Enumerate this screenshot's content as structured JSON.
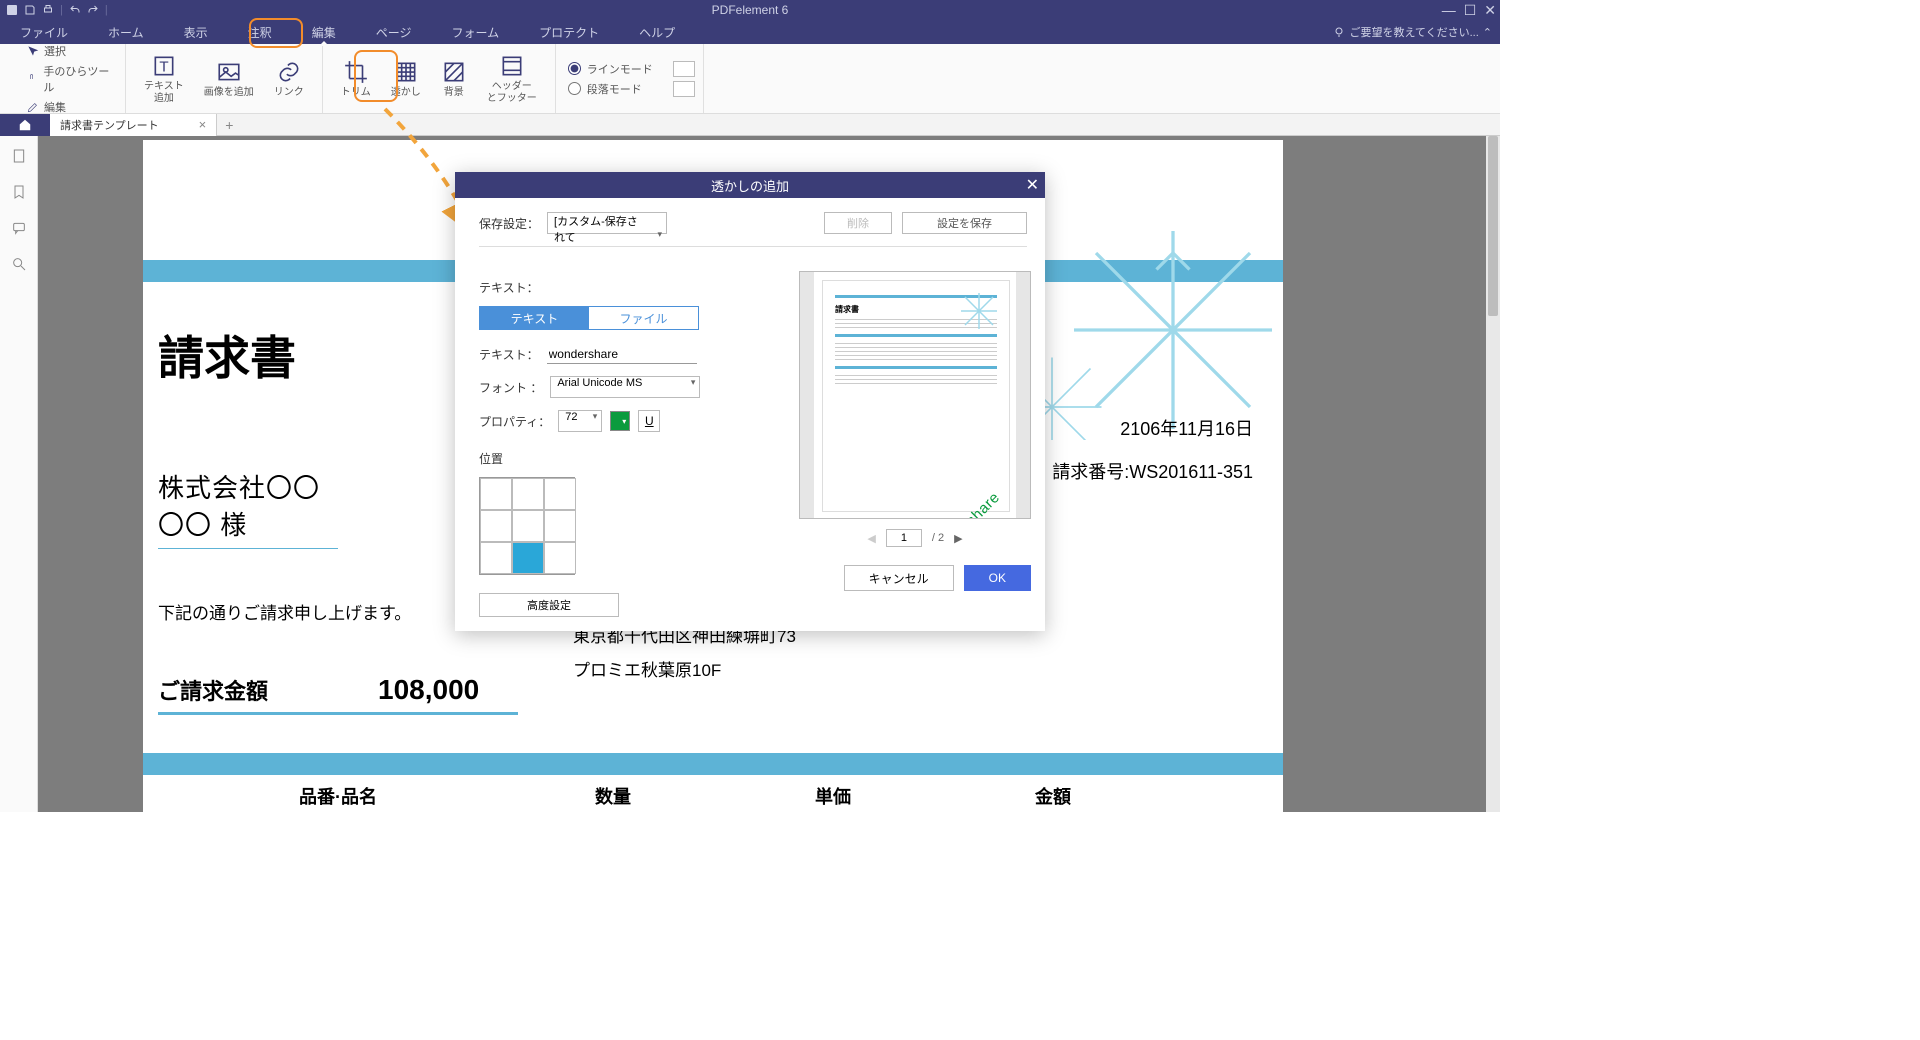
{
  "app": {
    "title": "PDFelement 6",
    "request_label": "ご要望を教えてください..."
  },
  "menu": {
    "file": "ファイル",
    "home": "ホーム",
    "view": "表示",
    "comment": "注釈",
    "edit": "編集",
    "page": "ページ",
    "form": "フォーム",
    "protect": "プロテクト",
    "help": "ヘルプ"
  },
  "ribbon": {
    "select": "選択",
    "hand": "手のひらツール",
    "edit": "編集",
    "text_add": "テキスト\n追加",
    "image_add": "画像を追加",
    "link": "リンク",
    "trim": "トリム",
    "watermark": "透かし",
    "background": "背景",
    "header_footer": "ヘッダー\nとフッター",
    "line_mode": "ラインモード",
    "para_mode": "段落モード"
  },
  "tabs": {
    "doc": "請求書テンプレート"
  },
  "document": {
    "title": "請求書",
    "date": "2106年11月16日",
    "invoice_no_label": "請求番号:",
    "invoice_no": "WS201611-351",
    "company_line1": "株式会社〇〇",
    "company_line2": "〇〇 様",
    "message": "下記の通りご請求申し上げます。",
    "address_line1": "東京都千代田区神田練塀町73",
    "address_line2": "プロミエ秋葉原10F",
    "amount_label": "ご請求金額",
    "amount_value": "108,000",
    "table_heads": [
      "品番·品名",
      "数量",
      "単価",
      "金額"
    ]
  },
  "dialog": {
    "title": "透かしの追加",
    "save_setting_label": "保存設定：",
    "save_setting_value": "[カスタム-保存されて",
    "delete_btn": "削除",
    "save_btn": "設定を保存",
    "text_section": "テキスト：",
    "tab_text": "テキスト",
    "tab_file": "ファイル",
    "text_label": "テキスト：",
    "text_value": "wondershare",
    "font_label": "フォント ：",
    "font_value": "Arial Unicode MS",
    "property_label": "プロパティ：",
    "font_size": "72",
    "underline_char": "U",
    "position_label": "位置",
    "advanced_btn": "高度設定",
    "preview_page": "1",
    "preview_total": "/ 2",
    "preview_title": "請求書",
    "preview_wm": "wondershare",
    "cancel": "キャンセル",
    "ok": "OK"
  }
}
